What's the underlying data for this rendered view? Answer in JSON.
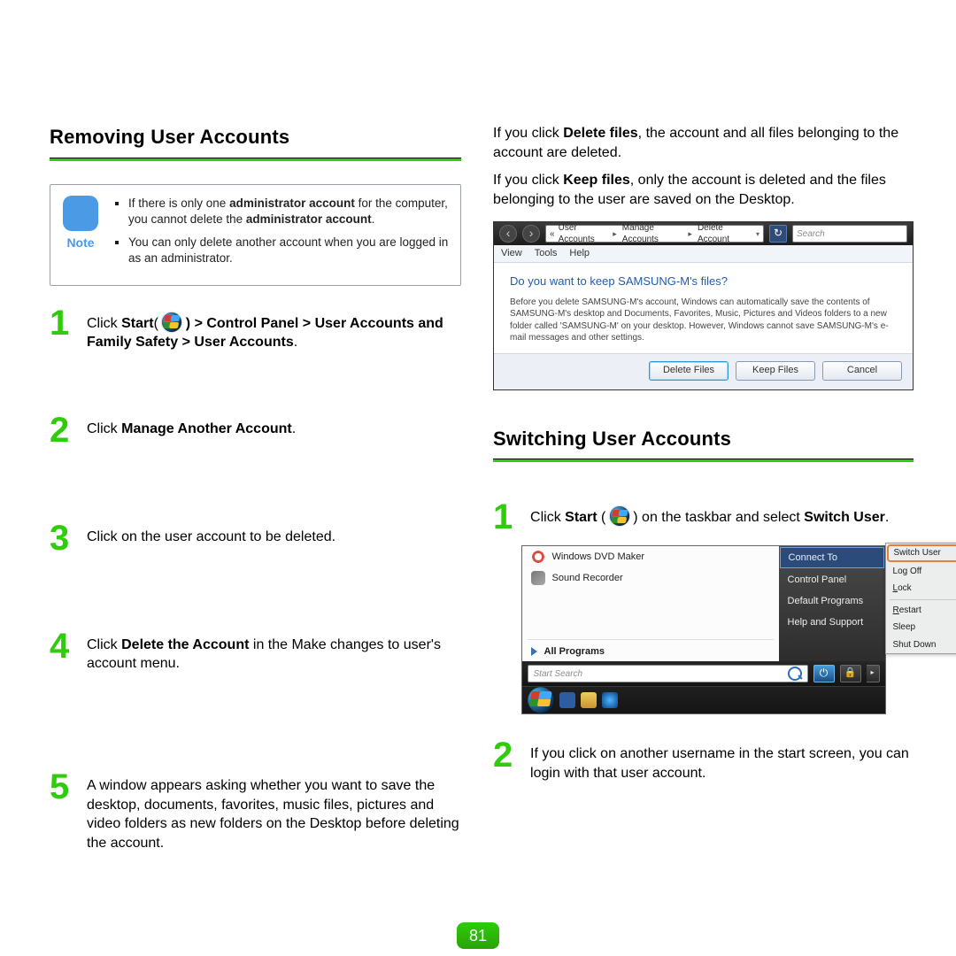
{
  "page_number": "81",
  "sections": {
    "heading_left": "Removing User Accounts",
    "heading_right_2": "Switching User Accounts"
  },
  "note": {
    "label": "Note",
    "items": [
      {
        "lead": "If there is only one ",
        "b1": "administrator account",
        "mid": " for the computer, you cannot delete the ",
        "b2": "administrator account",
        "tail": "."
      },
      {
        "text": "You can only delete another account when you are logged in as an administrator."
      }
    ]
  },
  "left_steps": {
    "s1": {
      "pre": "Click ",
      "start": "Start",
      "post": "( ",
      "path": " ) > Control Panel > User Accounts and Family Safety > User Accounts",
      "end": "."
    },
    "s2": {
      "pre": "Click ",
      "b": "Manage Another Account",
      "end": "."
    },
    "s3": {
      "text": "Click on the user account to be deleted."
    },
    "s4": {
      "pre": "Click ",
      "b": "Delete the Account",
      "post": " in the Make changes to user's account menu."
    },
    "s5": {
      "text": "A window appears asking whether you want to save the desktop, documents, favorites, music files, pictures and video folders as new folders on the Desktop before deleting the account."
    }
  },
  "right_paras": {
    "p1": {
      "pre": "If you click ",
      "b": "Delete files",
      "post": ", the account and all files belonging to the account are deleted."
    },
    "p2": {
      "pre": "If you click ",
      "b": "Keep files",
      "post": ", only the account is deleted and the files belonging to the user are saved on the Desktop."
    }
  },
  "dialog": {
    "breadcrumb": {
      "ua": "User Accounts",
      "ma": "Manage Accounts",
      "da": "Delete Account"
    },
    "search_placeholder": "Search",
    "menubar": {
      "view": "View",
      "tools": "Tools",
      "help": "Help"
    },
    "title": "Do you want to keep SAMSUNG-M's files?",
    "body": "Before you delete SAMSUNG-M's account, Windows can automatically save the contents of SAMSUNG-M's desktop and Documents, Favorites, Music, Pictures and Videos folders to a new folder called 'SAMSUNG-M' on your desktop. However, Windows cannot save SAMSUNG-M's e-mail messages and other settings.",
    "buttons": {
      "delete": "Delete Files",
      "keep": "Keep Files",
      "cancel": "Cancel"
    }
  },
  "right_steps": {
    "s1": {
      "pre": "Click ",
      "start": "Start",
      "mid": " ( ",
      "post": " ) on the taskbar and select ",
      "b": "Switch User",
      "end": "."
    },
    "s2": {
      "text": "If you click on another username in the start screen, you can login with that user account."
    }
  },
  "startmenu": {
    "left_items": {
      "dvd": "Windows DVD Maker",
      "sound": "Sound Recorder"
    },
    "all_programs": "All Programs",
    "search_placeholder": "Start Search",
    "right_items": {
      "connect": "Connect To",
      "cpanel": "Control Panel",
      "defprog": "Default Programs",
      "help": "Help and Support"
    },
    "flyout": {
      "switch": "Switch User",
      "logoff": "Log Off",
      "lock": "Lock",
      "restart": "Restart",
      "sleep": "Sleep",
      "shutdown": "Shut Down"
    }
  }
}
